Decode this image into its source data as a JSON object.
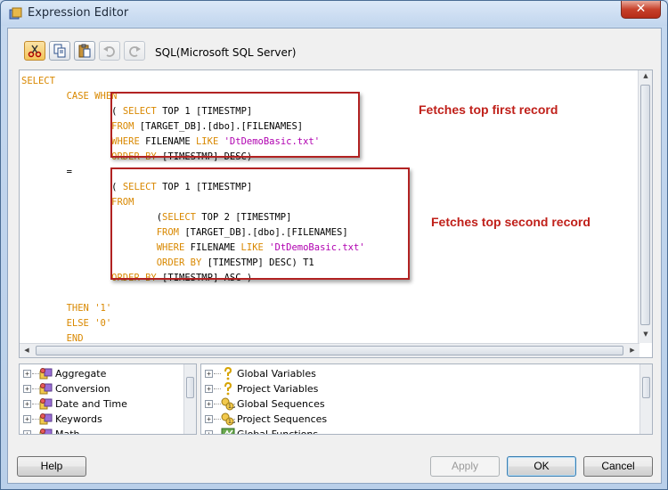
{
  "window": {
    "title": "Expression Editor",
    "close_glyph": "✕"
  },
  "toolbar": {
    "cut_tooltip": "Cut",
    "copy_tooltip": "Copy",
    "paste_tooltip": "Paste",
    "undo_tooltip": "Undo",
    "redo_tooltip": "Redo",
    "language_label": "SQL(Microsoft SQL Server)"
  },
  "editor": {
    "lines": [
      {
        "indent": "",
        "tokens": [
          {
            "t": "SELECT",
            "c": "kw"
          }
        ]
      },
      {
        "indent": "        ",
        "tokens": [
          {
            "t": "CASE WHEN",
            "c": "kw"
          }
        ]
      },
      {
        "indent": "                ",
        "tokens": [
          {
            "t": "( ",
            "c": "pl"
          },
          {
            "t": "SELECT",
            "c": "kw"
          },
          {
            "t": " TOP 1 [TIMESTMP]",
            "c": "pl"
          }
        ]
      },
      {
        "indent": "                ",
        "tokens": [
          {
            "t": "FROM",
            "c": "kw"
          },
          {
            "t": " [TARGET_DB].[dbo].[FILENAMES]",
            "c": "pl"
          }
        ]
      },
      {
        "indent": "                ",
        "tokens": [
          {
            "t": "WHERE",
            "c": "kw"
          },
          {
            "t": " FILENAME ",
            "c": "pl"
          },
          {
            "t": "LIKE",
            "c": "kw"
          },
          {
            "t": " ",
            "c": "pl"
          },
          {
            "t": "'DtDemoBasic.txt'",
            "c": "str"
          }
        ]
      },
      {
        "indent": "                ",
        "tokens": [
          {
            "t": "ORDER BY",
            "c": "kw"
          },
          {
            "t": " [TIMESTMP] DESC)",
            "c": "pl"
          }
        ]
      },
      {
        "indent": "        ",
        "tokens": [
          {
            "t": "=",
            "c": "pl"
          }
        ]
      },
      {
        "indent": "                ",
        "tokens": [
          {
            "t": "( ",
            "c": "pl"
          },
          {
            "t": "SELECT",
            "c": "kw"
          },
          {
            "t": " TOP 1 [TIMESTMP]",
            "c": "pl"
          }
        ]
      },
      {
        "indent": "                ",
        "tokens": [
          {
            "t": "FROM",
            "c": "kw"
          }
        ]
      },
      {
        "indent": "                        ",
        "tokens": [
          {
            "t": "(",
            "c": "pl"
          },
          {
            "t": "SELECT",
            "c": "kw"
          },
          {
            "t": " TOP 2 [TIMESTMP]",
            "c": "pl"
          }
        ]
      },
      {
        "indent": "                        ",
        "tokens": [
          {
            "t": "FROM",
            "c": "kw"
          },
          {
            "t": " [TARGET_DB].[dbo].[FILENAMES]",
            "c": "pl"
          }
        ]
      },
      {
        "indent": "                        ",
        "tokens": [
          {
            "t": "WHERE",
            "c": "kw"
          },
          {
            "t": " FILENAME ",
            "c": "pl"
          },
          {
            "t": "LIKE",
            "c": "kw"
          },
          {
            "t": " ",
            "c": "pl"
          },
          {
            "t": "'DtDemoBasic.txt'",
            "c": "str"
          }
        ]
      },
      {
        "indent": "                        ",
        "tokens": [
          {
            "t": "ORDER BY",
            "c": "kw"
          },
          {
            "t": " [TIMESTMP] DESC) T1",
            "c": "pl"
          }
        ]
      },
      {
        "indent": "                ",
        "tokens": [
          {
            "t": "ORDER BY",
            "c": "kw"
          },
          {
            "t": " [TIMESTMP] ASC )",
            "c": "pl"
          }
        ]
      },
      {
        "indent": "",
        "tokens": []
      },
      {
        "indent": "        ",
        "tokens": [
          {
            "t": "THEN",
            "c": "kw"
          },
          {
            "t": " ",
            "c": "pl"
          },
          {
            "t": "'1'",
            "c": "kw"
          }
        ]
      },
      {
        "indent": "        ",
        "tokens": [
          {
            "t": "ELSE",
            "c": "kw"
          },
          {
            "t": " ",
            "c": "pl"
          },
          {
            "t": "'0'",
            "c": "kw"
          }
        ]
      },
      {
        "indent": "        ",
        "tokens": [
          {
            "t": "END",
            "c": "kw"
          }
        ]
      }
    ],
    "annotations": {
      "first": "Fetches top first record",
      "second": "Fetches top second record"
    }
  },
  "functions_tree": {
    "items": [
      {
        "label": "Aggregate",
        "icon": "function-icon"
      },
      {
        "label": "Conversion",
        "icon": "function-icon"
      },
      {
        "label": "Date and Time",
        "icon": "function-icon"
      },
      {
        "label": "Keywords",
        "icon": "function-icon"
      },
      {
        "label": "Math",
        "icon": "function-icon"
      }
    ]
  },
  "variables_tree": {
    "items": [
      {
        "label": "Global Variables",
        "icon": "variable-icon"
      },
      {
        "label": "Project Variables",
        "icon": "variable-icon"
      },
      {
        "label": "Global Sequences",
        "icon": "sequence-icon"
      },
      {
        "label": "Project Sequences",
        "icon": "sequence-icon"
      },
      {
        "label": "Global Functions",
        "icon": "global-function-icon"
      }
    ]
  },
  "buttons": {
    "help": "Help",
    "apply": "Apply",
    "ok": "OK",
    "cancel": "Cancel"
  },
  "colors": {
    "keyword": "#d98800",
    "string": "#b000b0",
    "annotation": "#c0201a",
    "box": "#b22222"
  }
}
